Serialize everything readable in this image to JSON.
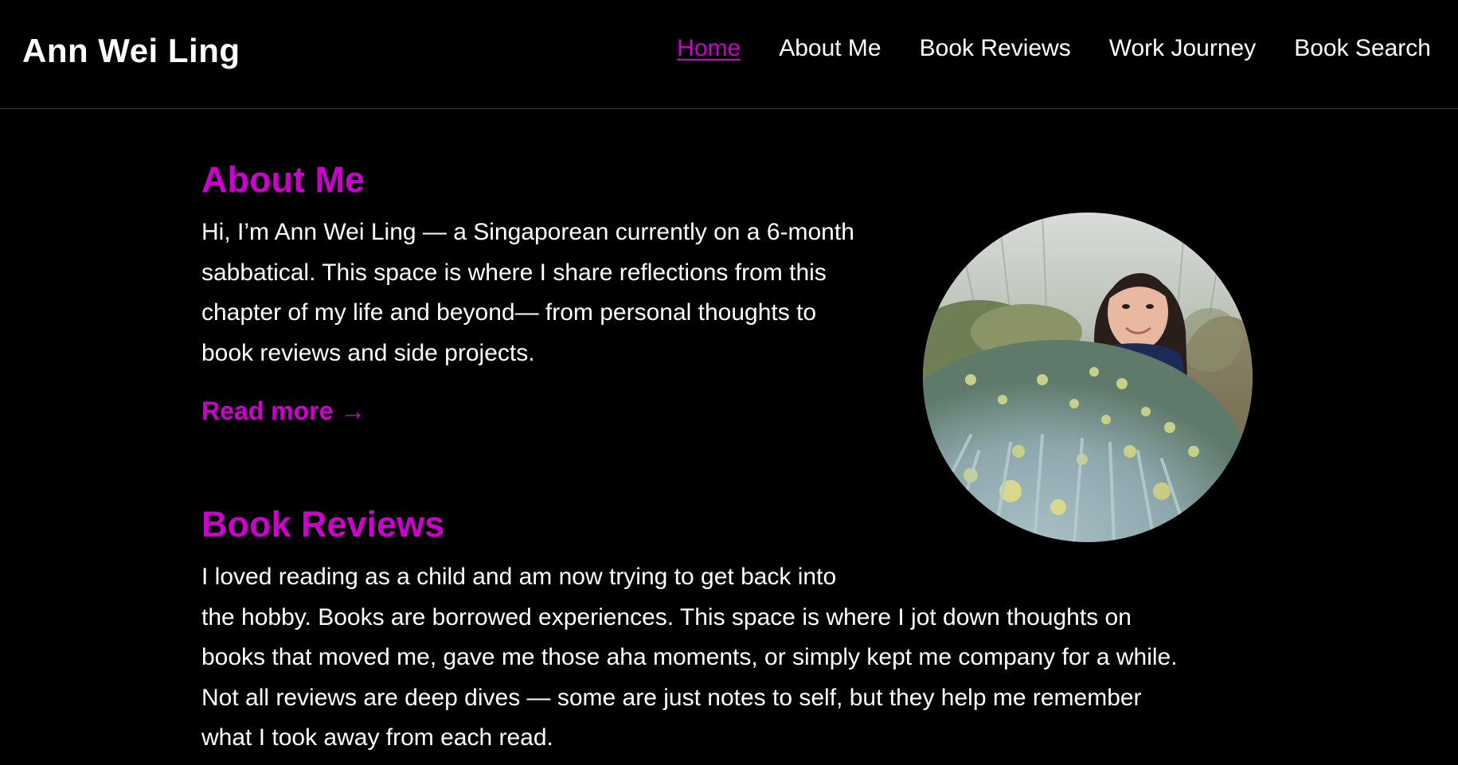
{
  "site": {
    "title": "Ann Wei Ling"
  },
  "nav": {
    "items": [
      {
        "label": "Home",
        "active": true
      },
      {
        "label": "About Me",
        "active": false
      },
      {
        "label": "Book Reviews",
        "active": false
      },
      {
        "label": "Work Journey",
        "active": false
      },
      {
        "label": "Book Search",
        "active": false
      }
    ]
  },
  "about": {
    "title": "About Me",
    "lines": [
      "Hi, I’m Ann Wei Ling — a Singaporean currently on a 6-month",
      "sabbatical. This space is where I share reflections from this",
      "chapter of my life and beyond— from personal thoughts to",
      "book reviews and side projects."
    ],
    "read_more": "Read more →"
  },
  "reviews": {
    "title": "Book Reviews",
    "lines": [
      "I loved reading as a child and am now trying to get back into",
      "the hobby. Books are borrowed experiences. This space is where I jot down thoughts on",
      "books that moved me, gave me those aha moments, or simply kept me company for a while.",
      "Not all reviews are deep dives — some are just notes to self, but they help me remember",
      "what I took away from each read."
    ]
  },
  "colors": {
    "background": "#000000",
    "accent": "#cc00cc",
    "text": "#ffffff"
  }
}
